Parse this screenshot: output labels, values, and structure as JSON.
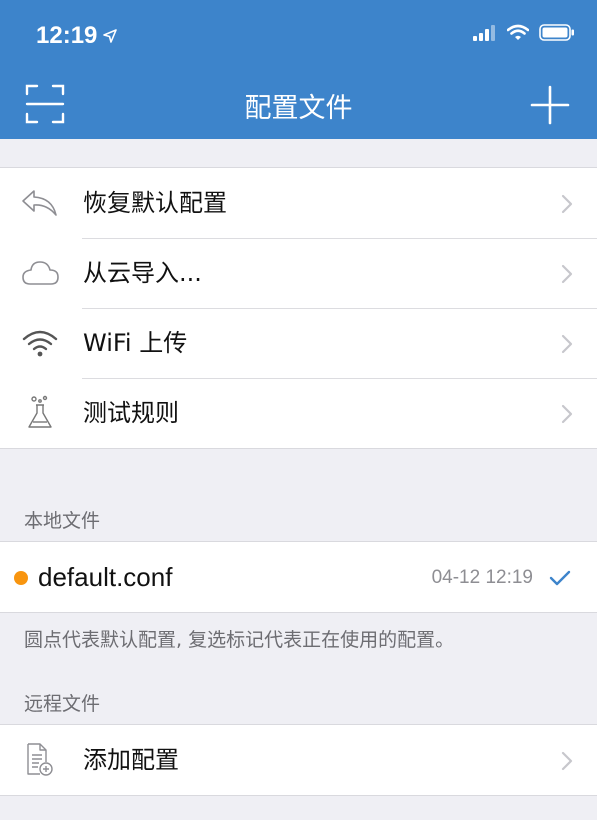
{
  "status_bar": {
    "time": "12:19",
    "icons": [
      "location-arrow-icon",
      "cellular-signal-icon",
      "wifi-icon",
      "battery-icon"
    ]
  },
  "nav": {
    "title": "配置文件",
    "left_icon": "scan-icon",
    "right_icon": "plus-icon"
  },
  "actions": [
    {
      "label": "恢复默认配置",
      "icon": "undo-arrow-icon"
    },
    {
      "label": "从云导入...",
      "icon": "cloud-icon"
    },
    {
      "label": "WiFi 上传",
      "icon": "wifi-icon"
    },
    {
      "label": "测试规则",
      "icon": "flask-icon"
    }
  ],
  "local": {
    "section_title": "本地文件",
    "files": [
      {
        "name": "default.conf",
        "time": "04-12 12:19",
        "is_default": true,
        "selected": true
      }
    ],
    "footnote": "圆点代表默认配置, 复选标记代表正在使用的配置。"
  },
  "remote": {
    "section_title": "远程文件",
    "add_label": "添加配置",
    "add_icon": "add-document-icon"
  },
  "colors": {
    "header": "#3d84cb",
    "background": "#efeff4",
    "default_dot": "#f8950f",
    "check": "#3d84cb"
  }
}
